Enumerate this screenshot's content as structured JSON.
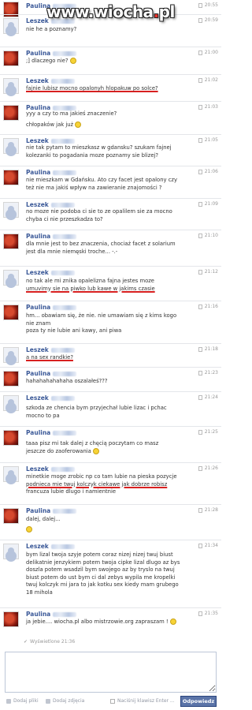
{
  "watermark": {
    "text_pre": "www.wiocha",
    "dot": ".",
    "text_post": "pl"
  },
  "messages": [
    {
      "sender": "Paulina",
      "time": "20:55",
      "lines": []
    },
    {
      "sender": "Leszek",
      "time": "20:59",
      "lines": [
        "nie he a poznamy?"
      ]
    },
    {
      "sender": "Paulina",
      "time": "21:00",
      "lines": [
        ";] dlaczego nie?"
      ]
    },
    {
      "sender": "Leszek",
      "time": "21:02",
      "lines": [
        "fajnie lubisz mocno opalonyh hlopakuw po solce?"
      ]
    },
    {
      "sender": "Paulina",
      "time": "21:03",
      "lines": [
        "yyy a czy to ma jakieś znaczenie?",
        "chłopaków jak już"
      ]
    },
    {
      "sender": "Leszek",
      "time": "21:05",
      "lines": [
        "nie tak pytam to mieszkasz w gdansku? szukam fajnej",
        "kolezanki to pogadania moze poznamy sie blizej?"
      ]
    },
    {
      "sender": "Paulina",
      "time": "21:06",
      "lines": [
        "nie mieszkam w Gdańsku. Ato czy facet jest opalony czy",
        "też nie ma jakiś wpływ na zawieranie znajomości ?"
      ]
    },
    {
      "sender": "Leszek",
      "time": "21:09",
      "lines": [
        "no moze nie podoba ci sie to ze opalilem sie za mocno",
        "chyba ci nie przeszkadza to?"
      ]
    },
    {
      "sender": "Paulina",
      "time": "21:10",
      "lines": [
        "dla mnie jest to bez znaczenia, chociaż facet z solarium",
        "jest dla mnie niemęski troche... -.-"
      ]
    },
    {
      "sender": "Leszek",
      "time": "21:12",
      "lines": [
        "no tak ale mi znika opalelizna fajna jestes moze",
        "umuvimy sie na piwko lub kawe w jakims czasie"
      ]
    },
    {
      "sender": "Paulina",
      "time": "21:16",
      "lines": [
        "hm... obawiam się, że nie. nie umawiam się z kims kogo",
        "nie znam",
        "poza ty nie lubie ani kawy, ani piwa"
      ]
    },
    {
      "sender": "Leszek",
      "time": "21:18",
      "lines": [
        "a na sex randkie?"
      ]
    },
    {
      "sender": "Paulina",
      "time": "21:23",
      "lines": [
        "hahahahahahaha oszalałeś???"
      ]
    },
    {
      "sender": "Leszek",
      "time": "21:24",
      "lines": [
        "szkoda ze chencia bym przyjechał lubie lizac i pchac",
        "mocno to pa"
      ]
    },
    {
      "sender": "Paulina",
      "time": "21:25",
      "lines": [
        "taaa pisz mi tak dalej z chęcią poczytam co masz",
        "jeszcze do zaoferowania"
      ]
    },
    {
      "sender": "Leszek",
      "time": "21:26",
      "lines": [
        "minetkie moge zrobic np co tam lubie na pieska pozycje",
        "podnieca mie twuj kolczyk ciekawe jak dobrze robisz",
        "francuza lubie dlugo i namientnie"
      ]
    },
    {
      "sender": "Paulina",
      "time": "21:28",
      "lines": [
        "dalej, dalej..."
      ]
    },
    {
      "sender": "Leszek",
      "time": "21:34",
      "lines": [
        "bym lizal twoja szyje potem coraz nizej nizej twuj biust",
        "delikatnie jenzykiem potem twoja cipke lizal dlugo az bys",
        "doszla potem wsadzil bym swojego az by tryslo na twuj",
        "biust potem do ust bym ci dal zebys wypila me kropelki",
        "twuj kolczyk mi jara to jak kotku sex kiedy mam grubego",
        "18 mihola"
      ]
    },
    {
      "sender": "Paulina",
      "time": "21:35",
      "lines": [
        "ja jebie.... wiocha.pl albo mistrzowie.org  zapraszam !"
      ]
    }
  ],
  "seen_label": "Wyświetlone 21:36",
  "composer": {
    "value": ""
  },
  "toolbar": {
    "add_files": "Dodaj pliki",
    "add_photo": "Dodaj zdjęcia",
    "enter_hint": "Naciśnij klawisz Enter ...",
    "reply": "Odpowiedz"
  }
}
